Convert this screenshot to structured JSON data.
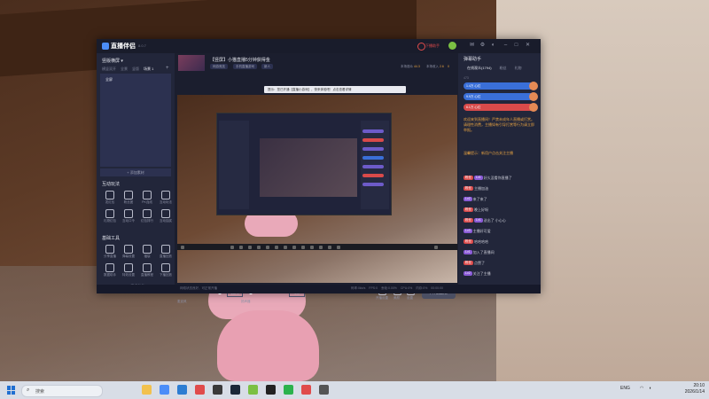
{
  "app": {
    "name": "直播伴侣",
    "version": "8.0.7",
    "titlebar": {
      "gift_label": "下播助手",
      "icons": [
        "mail-icon",
        "settings-icon",
        "skin-icon",
        "minimize-icon",
        "maximize-icon",
        "close-icon"
      ]
    }
  },
  "left": {
    "header": "竖版横屏 ▾",
    "tabs": [
      "横竖双开",
      "全景",
      "竖版",
      "场景 1"
    ],
    "scenes": [
      "全屏",
      "",
      ""
    ],
    "add_source": "+ 添加素材",
    "interact_title": "互动玩法",
    "interact_items": [
      "发红包",
      "粉丝团",
      "PK连线",
      "互动玩法",
      "礼物红包",
      "互动口令",
      "红包排行",
      "互动抽奖"
    ],
    "tools_title": "基础工具",
    "tools_items": [
      "分享直播",
      "弹幕设置",
      "福袋",
      "直播回放",
      "数据助手",
      "特效设置",
      "直播教程",
      "下播回放"
    ],
    "more_tools": "··· 更多功能"
  },
  "center": {
    "room_title": "【竖屏】小猫直播5分钟获得金",
    "room_sub": "直播分区  游戏",
    "tags": [
      "网游竞技",
      "手机直播游戏",
      "新人"
    ],
    "stats": [
      {
        "label": "本场观众",
        "value": "44.3"
      },
      {
        "label": "本场收入",
        "value": "2.6"
      },
      {
        "label": "粉丝团",
        "value": "0"
      }
    ],
    "notice": "提示：您已开通【直播小游戏】，快来体验吧！点击查看详情",
    "bottom": {
      "mic_label": "麦克风",
      "mic_value": "100%",
      "mic_level": 0.9,
      "speaker_label": "扬声器",
      "speaker_value": "0%",
      "speaker_level": 0.0,
      "tools": [
        "开播设置",
        "美颜",
        "设置"
      ],
      "live_button": "开始直播"
    }
  },
  "status": {
    "left": "网络状态良好，可正常开播",
    "right": "码率:0kb/s  FPS:0  丢帧:0.00%  CPU:0%  内存:0%  00:00:00"
  },
  "right": {
    "title": "弹幕助手",
    "tabs": [
      "在线观众(1794)",
      "粉丝",
      "礼物"
    ],
    "stats": "473",
    "ranks": [
      "1.4万 心红",
      "9.9万 心红",
      "6.1万 心红"
    ],
    "system_msg": "欢迎来到直播间！严禁未成年人直播或打赏。请理性消费，主播如有引导打赏等行为请立即举报。",
    "system_msg2": "温馨提示：新用户点击关注主播",
    "chats": [
      {
        "badges": [
          "粉丝",
          "Lv1"
        ],
        "text": "好久没看你直播了"
      },
      {
        "badges": [
          "粉丝"
        ],
        "text": "主播加油"
      },
      {
        "badges": [
          "Lv2"
        ],
        "text": "来了来了"
      },
      {
        "badges": [
          "粉丝"
        ],
        "text": "晚上好呀"
      },
      {
        "badges": [
          "粉丝",
          "Lv1"
        ],
        "text": "送出了 小心心"
      },
      {
        "badges": [
          "Lv3"
        ],
        "text": "主播好可爱"
      },
      {
        "badges": [
          "粉丝"
        ],
        "text": "哈哈哈哈"
      },
      {
        "badges": [
          "Lv1"
        ],
        "text": "加入了直播间"
      },
      {
        "badges": [
          "粉丝"
        ],
        "text": "点赞了"
      },
      {
        "badges": [
          "Lv2"
        ],
        "text": "关注了主播"
      }
    ]
  },
  "taskbar": {
    "search_placeholder": "搜索",
    "apps": [
      "files-icon",
      "browser-icon",
      "store-icon",
      "music-icon",
      "game-icon",
      "steam-icon",
      "app-icon",
      "capcut-icon",
      "chat-icon",
      "live-icon",
      "settings-icon"
    ],
    "tray_lang": "ENG",
    "time": "20:10",
    "date": "2026/1/14"
  },
  "colors": {
    "accent": "#3a6fd8",
    "warning": "#e8a341",
    "live_button": "#4a4e63"
  }
}
